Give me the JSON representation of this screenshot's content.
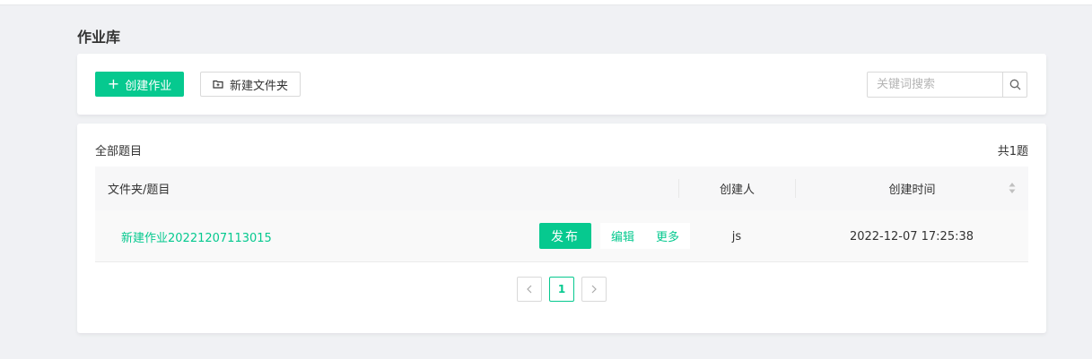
{
  "page": {
    "title": "作业库"
  },
  "toolbar": {
    "create_label": "创建作业",
    "folder_label": "新建文件夹",
    "search_placeholder": "关键词搜索",
    "search_value": ""
  },
  "list": {
    "title": "全部题目",
    "count": "共1题",
    "columns": {
      "name": "文件夹/题目",
      "creator": "创建人",
      "time": "创建时间"
    },
    "rows": [
      {
        "name": "新建作业20221207113015",
        "publish": "发布",
        "edit": "编辑",
        "more": "更多",
        "creator": "js",
        "time": "2022-12-07 17:25:38"
      }
    ]
  },
  "pagination": {
    "current": "1"
  },
  "colors": {
    "accent": "#06c98f",
    "background": "#f0f1f4"
  },
  "icons": [
    "plus-icon",
    "folder-icon",
    "search-icon",
    "sort-icon",
    "chevron-left-icon",
    "chevron-right-icon"
  ]
}
